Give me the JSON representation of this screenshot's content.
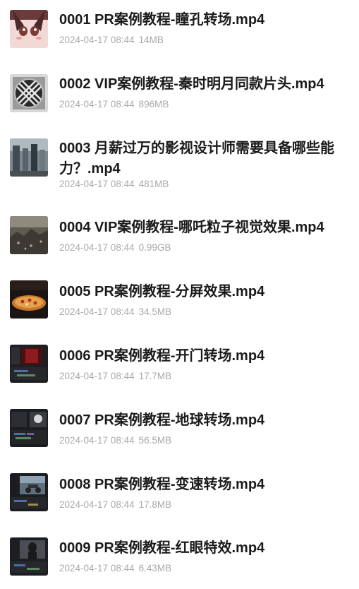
{
  "files": [
    {
      "name": "0001 PR案例教程-瞳孔转场.mp4",
      "date": "2024-04-17 08:44",
      "size": "14MB",
      "thumb_icon": "anime-girl-thumbnail"
    },
    {
      "name": "0002 VIP案例教程-秦时明月同款片头.mp4",
      "date": "2024-04-17 08:44",
      "size": "896MB",
      "thumb_icon": "checkered-disc-thumbnail"
    },
    {
      "name": "0003 月薪过万的影视设计师需要具备哪些能力？.mp4",
      "date": "2024-04-17 08:44",
      "size": "481MB",
      "thumb_icon": "city-street-thumbnail"
    },
    {
      "name": "0004 VIP案例教程-哪吒粒子视觉效果.mp4",
      "date": "2024-04-17 08:44",
      "size": "0.99GB",
      "thumb_icon": "rubble-scene-thumbnail"
    },
    {
      "name": "0005 PR案例教程-分屏效果.mp4",
      "date": "2024-04-17 08:44",
      "size": "34.5MB",
      "thumb_icon": "pizza-thumbnail"
    },
    {
      "name": "0006 PR案例教程-开门转场.mp4",
      "date": "2024-04-17 08:44",
      "size": "17.7MB",
      "thumb_icon": "editor-red-door-thumbnail"
    },
    {
      "name": "0007 PR案例教程-地球转场.mp4",
      "date": "2024-04-17 08:44",
      "size": "56.5MB",
      "thumb_icon": "editor-timeline-thumbnail"
    },
    {
      "name": "0008 PR案例教程-变速转场.mp4",
      "date": "2024-04-17 08:44",
      "size": "17.8MB",
      "thumb_icon": "editor-motorcycle-thumbnail"
    },
    {
      "name": "0009 PR案例教程-红眼特效.mp4",
      "date": "2024-04-17 08:44",
      "size": "6.43MB",
      "thumb_icon": "editor-figure-thumbnail"
    }
  ]
}
